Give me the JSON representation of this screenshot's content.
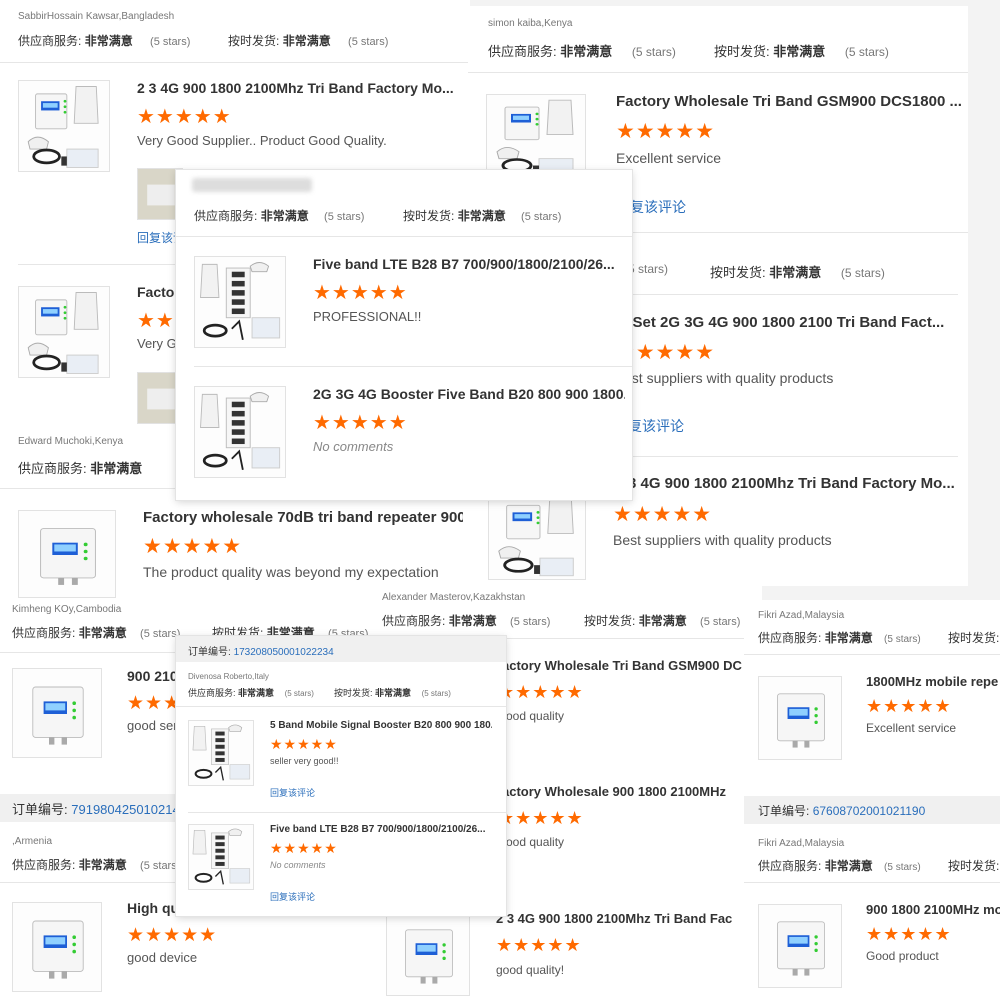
{
  "ratings": {
    "supplier_label": "供应商服务:",
    "supplier_value": "非常满意",
    "shipping_label": "按时发货:",
    "shipping_value": "非常满意",
    "stars_text": "(5 stars)"
  },
  "common": {
    "reply_link": "回复该评论",
    "star_glyph": "★★★★★",
    "order_label": "订单编号:"
  },
  "colors": {
    "star": "#ff6a00",
    "link": "#2a6ebb",
    "accent_blue": "#1e5fd6"
  },
  "cards": {
    "c1": {
      "user": "SabbirHossain Kawsar,Bangladesh",
      "items": [
        {
          "title": "2 3 4G 900 1800 2100Mhz Tri Band Factory Mo...",
          "comment": "Very Good Supplier..  Product Good Quality."
        },
        {
          "title": "Factor",
          "comment": "Very G"
        }
      ]
    },
    "c2": {
      "user": "simon kaiba,Kenya",
      "items": [
        {
          "title": "Factory Wholesale Tri Band GSM900 DCS1800 ...",
          "comment": "Excellent service",
          "reply": "复该评论"
        },
        {
          "title": "ll Set 2G 3G 4G 900 1800 2100 Tri Band Fact...",
          "comment": "est suppliers with quality products",
          "reply": "复该评论"
        },
        {
          "title": "3 4G 900 1800 2100Mhz Tri Band Factory Mo...",
          "comment": "Best suppliers with quality products"
        }
      ],
      "partial_stars": "5 stars)"
    },
    "c3": {
      "items": [
        {
          "title": "Five band LTE B28 B7 700/900/1800/2100/26...",
          "comment": "PROFESSIONAL!!"
        },
        {
          "title": "2G 3G 4G Booster Five Band B20 800 900 1800...",
          "comment": "No comments"
        }
      ]
    },
    "c4": {
      "user": "Edward Muchoki,Kenya",
      "items": [
        {
          "title": "Factory wholesale 70dB tri band repeater 900 ...",
          "comment": "The product quality was beyond my expectation"
        }
      ]
    },
    "c5": {
      "user": "Kimheng KOy,Cambodia",
      "order_number": "7919804250102146",
      "items": [
        {
          "title": "900 210",
          "comment": "good serv"
        },
        {
          "title": "High qu",
          "comment": "good device"
        }
      ],
      "user2": ",Armenia"
    },
    "c6": {
      "user": "Alexander Masterov,Kazakhstan",
      "items": [
        {
          "title": "actory Wholesale Tri Band GSM900 DC",
          "comment": "ood quality"
        },
        {
          "title": "actory Wholesale 900 1800 2100MHz",
          "comment": "ood quality"
        },
        {
          "title": "2 3 4G 900 1800 2100Mhz Tri Band Fac",
          "comment": "good quality!"
        }
      ]
    },
    "c7": {
      "user": "Fikri Azad,Malaysia",
      "order_number": "67608702001021190",
      "items": [
        {
          "title": "1800MHz mobile repe",
          "comment": "Excellent service"
        },
        {
          "title": "900 1800 2100MHz mo",
          "comment": "Good product"
        }
      ],
      "user2": "Fikri Azad,Malaysia"
    },
    "c8": {
      "order_number": "173208050001022234",
      "user": "Divenosa Roberto,Italy",
      "items": [
        {
          "title": "5 Band Mobile Signal Booster B20 800 900 180...",
          "comment": "seller very good!!"
        },
        {
          "title": "Five band LTE B28 B7 700/900/1800/2100/26...",
          "comment": "No comments"
        }
      ]
    }
  }
}
